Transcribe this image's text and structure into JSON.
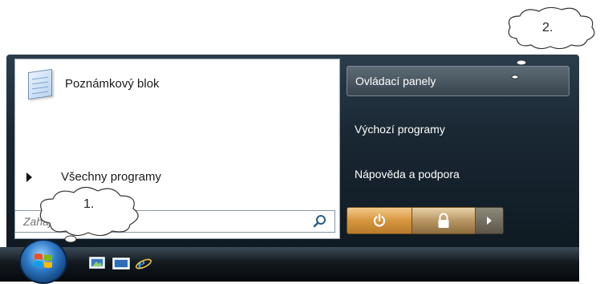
{
  "start_menu": {
    "pinned_program": "Poznámkový blok",
    "all_programs": "Všechny programy",
    "search_placeholder": "Zahájit hledání"
  },
  "right_pane": {
    "items": [
      "Ovládací panely",
      "Výchozí programy",
      "Nápověda a podpora"
    ]
  },
  "callouts": {
    "one": "1.",
    "two": "2."
  },
  "icons": {
    "notepad": "notepad-icon",
    "search": "search-icon",
    "power": "power-icon",
    "lock": "lock-icon",
    "menu_arrow": "arrow-right-icon",
    "start": "windows-start-orb",
    "quick_launch": [
      "show-desktop-icon",
      "switch-windows-icon",
      "internet-explorer-icon"
    ]
  },
  "colors": {
    "power_button": "#d6963e",
    "menu_dark": "#1a2834"
  }
}
